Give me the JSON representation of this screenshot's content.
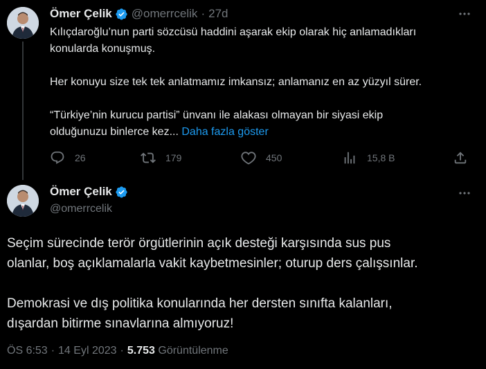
{
  "parent_tweet": {
    "author_name": "Ömer Çelik",
    "handle": "@omerrcelik",
    "separator": "·",
    "time": "27d",
    "lines": [
      "Kılıçdaroğlu’nun parti sözcüsü haddini aşarak ekip olarak hiç anlamadıkları",
      "konularda konuşmuş.",
      "Her konuyu size tek tek anlatmamız imkansız; anlamanız en az yüzyıl sürer.",
      "“Türkiye’nin kurucu partisi” ünvanı ile alakası olmayan bir siyasi ekip",
      "olduğunuzu binlerce kez..."
    ],
    "show_more": "Daha fazla göster",
    "actions": {
      "reply_count": "26",
      "repost_count": "179",
      "like_count": "450",
      "views_count": "15,8 B"
    }
  },
  "main_tweet": {
    "author_name": "Ömer Çelik",
    "handle": "@omerrcelik",
    "lines": [
      "Seçim sürecinde terör örgütlerinin açık desteği karşısında sus pus",
      "olanlar, boş açıklamalarla vakit kaybetmesinler; oturup ders çalışsınlar.",
      "Demokrasi ve dış politika konularında her dersten sınıfta kalanları,",
      "dışardan bitirme sınavlarına almıyoruz!"
    ],
    "time": "ÖS 6:53",
    "sep1": "·",
    "date": "14 Eyl 2023",
    "sep2": "·",
    "views": "5.753",
    "views_label": "Görüntülenme"
  },
  "colors": {
    "background": "#000000",
    "text": "#e7e9ea",
    "secondary_text": "#71767b",
    "link": "#1d9bf0",
    "verified_badge": "#1d9bf0"
  },
  "icons": [
    "avatar",
    "verified-badge-icon",
    "more-icon",
    "reply-icon",
    "repost-icon",
    "like-icon",
    "views-icon",
    "share-icon"
  ]
}
